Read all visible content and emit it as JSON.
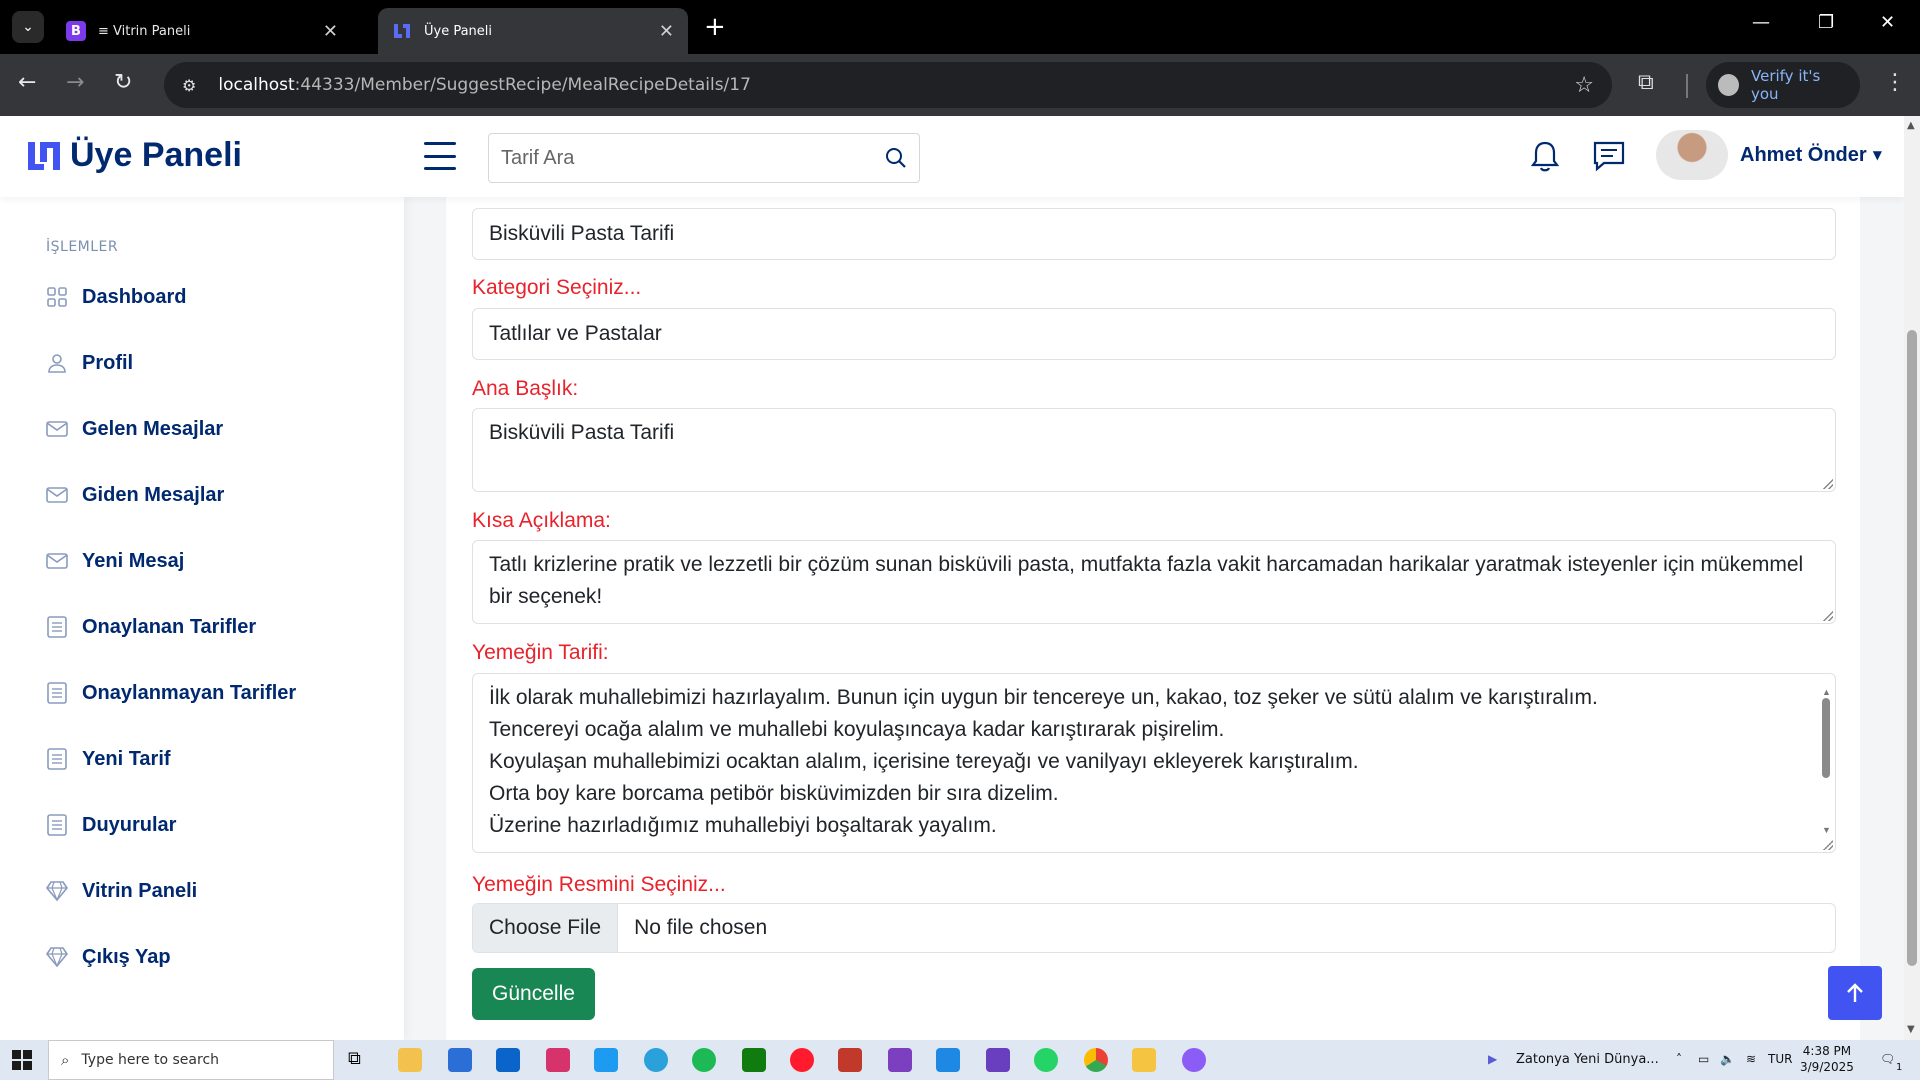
{
  "browser": {
    "tabs": [
      {
        "title": "≡ Vitrin Paneli",
        "favicon_letter": "B",
        "favicon_color": "#7c3aed",
        "active": false
      },
      {
        "title": "Üye Paneli",
        "favicon_letter": "",
        "favicon_color": "#4154f1",
        "active": true
      }
    ],
    "url_host": "localhost",
    "url_path": ":44333/Member/SuggestRecipe/MealRecipeDetails/17",
    "profile_label": "Verify it's you"
  },
  "header": {
    "brand": "Üye Paneli",
    "search_placeholder": "Tarif Ara",
    "user_name": "Ahmet Önder",
    "brand_color": "#012970",
    "accent_color": "#4154f1"
  },
  "sidebar": {
    "heading": "İŞLEMLER",
    "items": [
      {
        "label": "Dashboard",
        "icon": "grid-icon"
      },
      {
        "label": "Profil",
        "icon": "person-icon"
      },
      {
        "label": "Gelen Mesajlar",
        "icon": "envelope-icon"
      },
      {
        "label": "Giden Mesajlar",
        "icon": "envelope-icon"
      },
      {
        "label": "Yeni Mesaj",
        "icon": "envelope-icon"
      },
      {
        "label": "Onaylanan Tarifler",
        "icon": "list-icon"
      },
      {
        "label": "Onaylanmayan Tarifler",
        "icon": "list-icon"
      },
      {
        "label": "Yeni Tarif",
        "icon": "list-icon"
      },
      {
        "label": "Duyurular",
        "icon": "list-icon"
      },
      {
        "label": "Vitrin Paneli",
        "icon": "gem-icon"
      },
      {
        "label": "Çıkış Yap",
        "icon": "gem-icon"
      }
    ]
  },
  "form": {
    "label_color": "#e8232c",
    "meal_name_value": "Bisküvili Pasta Tarifi",
    "category_label": "Kategori Seçiniz...",
    "category_value": "Tatlılar ve Pastalar",
    "title_label": "Ana Başlık:",
    "title_value": "Bisküvili Pasta Tarifi",
    "short_desc_label": "Kısa Açıklama:",
    "short_desc_value": "Tatlı krizlerine pratik ve lezzetli bir çözüm sunan bisküvili pasta, mutfakta fazla vakit harcamadan harikalar yaratmak isteyenler için mükemmel bir seçenek!",
    "recipe_label": "Yemeğin Tarifi:",
    "recipe_lines": [
      "İlk olarak muhallebimizi hazırlayalım. Bunun için uygun bir tencereye un, kakao, toz şeker ve sütü alalım ve karıştıralım.",
      "Tencereyi ocağa alalım ve muhallebi koyulaşıncaya kadar karıştırarak pişirelim.",
      "Koyulaşan muhallebimizi ocaktan alalım, içerisine tereyağı ve vanilyayı ekleyerek karıştıralım.",
      "Orta boy kare borcama petibör bisküvimizden bir sıra dizelim.",
      "Üzerine hazırladığımız muhallebiyi boşaltarak yayalım."
    ],
    "image_label": "Yemeğin Resmini Seçiniz...",
    "file_button": "Choose File",
    "file_status": "No file chosen",
    "submit_label": "Güncelle",
    "submit_color": "#198754"
  },
  "taskbar": {
    "search_placeholder": "Type here to search",
    "notification_text": "Zatonya Yeni Dünya...",
    "language": "TUR",
    "time": "4:38 PM",
    "date": "3/9/2025",
    "notification_count": "1"
  }
}
